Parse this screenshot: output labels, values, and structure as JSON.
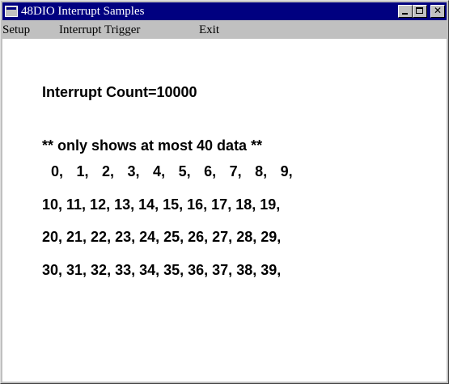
{
  "window": {
    "title": "48DIO Interrupt Samples",
    "icon": "app-window-icon",
    "controls": {
      "minimize": "minimize-icon",
      "maximize": "maximize-icon",
      "close": "close-icon",
      "close_glyph": "✕"
    }
  },
  "menu": {
    "items": [
      "Setup",
      "Interrupt Trigger",
      "Exit"
    ]
  },
  "content": {
    "count_line": "Interrupt Count=10000",
    "note_line": "** only shows at most 40 data **",
    "data_rows": [
      "  0,   1,   2,   3,   4,   5,   6,   7,   8,   9,",
      "10, 11, 12, 13, 14, 15, 16, 17, 18, 19,",
      "20, 21, 22, 23, 24, 25, 26, 27, 28, 29,",
      "30, 31, 32, 33, 34, 35, 36, 37, 38, 39,"
    ]
  },
  "colors": {
    "titlebar": "#000080",
    "window_face": "#c0c0c0",
    "client": "#ffffff"
  }
}
